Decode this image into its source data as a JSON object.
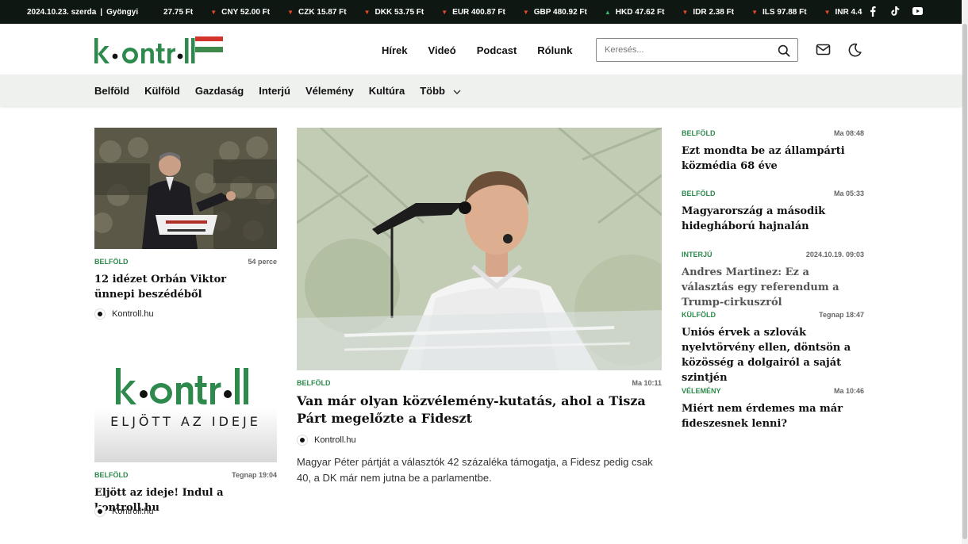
{
  "ticker": {
    "date": "2024.10.23. szerda",
    "nameday": "Gyöngyi",
    "rates": [
      {
        "dir": "none",
        "text": "27.75 Ft"
      },
      {
        "dir": "down",
        "text": "CNY 52.00 Ft"
      },
      {
        "dir": "down",
        "text": "CZK 15.87 Ft"
      },
      {
        "dir": "down",
        "text": "DKK 53.75 Ft"
      },
      {
        "dir": "down",
        "text": "EUR 400.87 Ft"
      },
      {
        "dir": "down",
        "text": "GBP 480.92 Ft"
      },
      {
        "dir": "up",
        "text": "HKD 47.62 Ft"
      },
      {
        "dir": "down",
        "text": "IDR 2.38 Ft"
      },
      {
        "dir": "down",
        "text": "ILS 97.88 Ft"
      },
      {
        "dir": "down",
        "text": "INR 4.4"
      }
    ]
  },
  "header": {
    "nav": [
      "Hírek",
      "Videó",
      "Podcast",
      "Rólunk"
    ],
    "search_placeholder": "Keresés..."
  },
  "categories": [
    "Belföld",
    "Külföld",
    "Gazdaság",
    "Interjú",
    "Vélemény",
    "Kultúra"
  ],
  "more_label": "Több",
  "left": [
    {
      "category": "Belföld",
      "time": "54 perce",
      "title": "12 idézet Orbán Viktor ünnepi beszédéből",
      "author": "Kontroll.hu"
    },
    {
      "category": "Belföld",
      "time": "Tegnap 19:04",
      "title": "Eljött az ideje! Indul a kontroll.hu",
      "author": "Kontroll.hu",
      "image_caption": "ELJÖTT AZ IDEJE"
    }
  ],
  "feature": {
    "category": "Belföld",
    "time": "Ma 10:11",
    "title": "Van már olyan közvélemény-kutatás, ahol a Tisza Párt megelőzte a Fideszt",
    "author": "Kontroll.hu",
    "lead": "Magyar Péter pártját a választók 42 százaléka támogatja, a Fidesz pedig csak 40, a DK már nem jutna be a parlamentbe."
  },
  "right": [
    {
      "category": "Belföld",
      "time": "Ma 08:48",
      "title": "Ezt mondta be az állampárti közmédia 68 éve"
    },
    {
      "category": "Belföld",
      "time": "Ma 05:33",
      "title": "Magyarország a második hidegháború hajnalán"
    },
    {
      "category": "Interjú",
      "time": "2024.10.19. 09:03",
      "title": "Andres Martinez: Ez a választás egy referendum a Trump-cirkuszról"
    },
    {
      "category": "Külföld",
      "time": "Tegnap 18:47",
      "title": "Uniós érvek a szlovák nyelvtörvény ellen, döntsön a közösség a dolgairól a saját szintjén"
    },
    {
      "category": "Vélemény",
      "time": "Ma 10:46",
      "title": "Miért nem érdemes ma már fideszesnek lenni?"
    }
  ],
  "colors": {
    "brand_green": "#2d8a4c",
    "flag_red": "#d2342b",
    "flag_green": "#3d8a4a",
    "ticker_bg": "#0f1713"
  }
}
